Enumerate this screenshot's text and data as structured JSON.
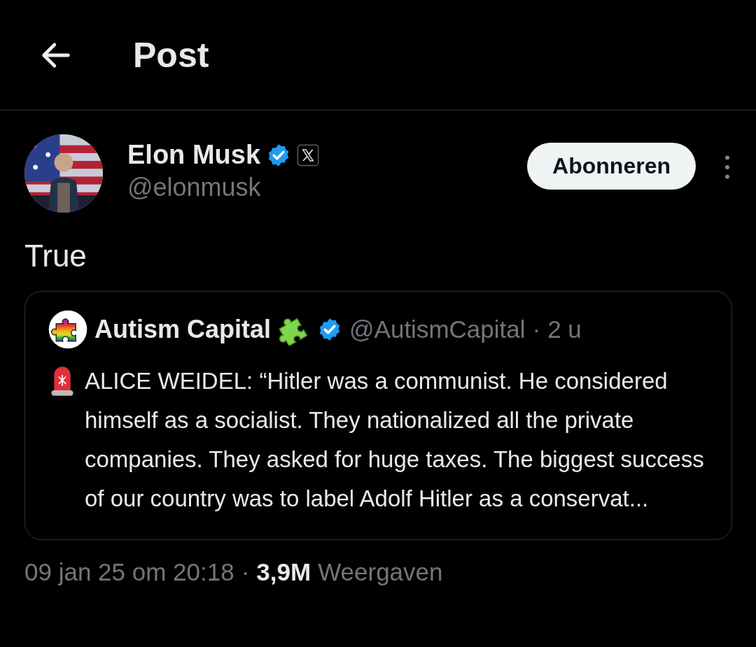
{
  "header": {
    "title": "Post"
  },
  "post": {
    "author": {
      "name": "Elon Musk",
      "verified": true,
      "handle": "@elonmusk"
    },
    "follow_button": "Abonneren",
    "text": "True",
    "quote": {
      "author": {
        "name": "Autism Capital",
        "verified": true,
        "handle": "@AutismCapital"
      },
      "separator": "·",
      "time": "2 u",
      "text": "ALICE WEIDEL: “Hitler was a communist. He considered himself as a socialist. They nationalized all the private companies. They asked for huge taxes. The biggest success of our country was to label Adolf Hitler as a conservat..."
    },
    "timestamp": "09 jan 25 om 20:18",
    "separator": "·",
    "views": "3,9M",
    "views_label": "Weergaven"
  }
}
